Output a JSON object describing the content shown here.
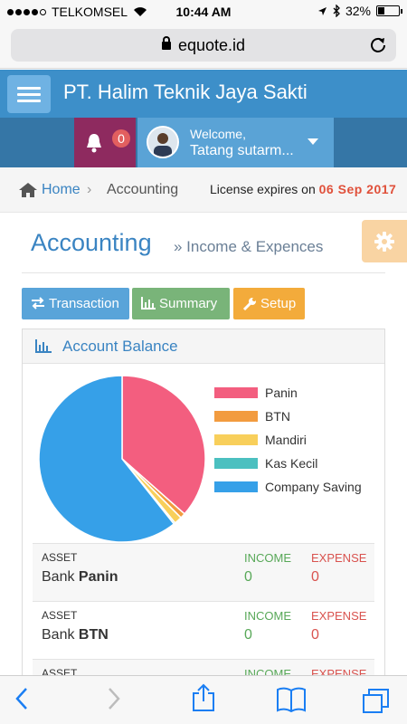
{
  "status_bar": {
    "carrier": "TELKOMSEL",
    "time": "10:44 AM",
    "battery_text": "32%",
    "battery_level": 0.32
  },
  "browser": {
    "url": "equote.id"
  },
  "header": {
    "company": "PT. Halim Teknik Jaya Sakti"
  },
  "notifications": {
    "count": "0"
  },
  "user": {
    "welcome": "Welcome,",
    "name": "Tatang sutarm..."
  },
  "breadcrumb": {
    "home": "Home",
    "separator": "›",
    "current": "Accounting"
  },
  "license": {
    "label": "License expires on",
    "date": "06 Sep 2017"
  },
  "page": {
    "title": "Accounting",
    "subtitle": "» Income & Expences"
  },
  "buttons": {
    "transaction": "Transaction",
    "summary": "Summary",
    "setup": "Setup"
  },
  "panel": {
    "title": "Account Balance"
  },
  "chart_data": {
    "type": "pie",
    "labels": [
      "Panin",
      "BTN",
      "Mandiri",
      "Kas Kecil",
      "Company Saving"
    ],
    "values": [
      36.5,
      1.0,
      1.5,
      0.3,
      60.7
    ],
    "colors": [
      "#f35e7f",
      "#f29b3f",
      "#f8cf5b",
      "#4bc0c0",
      "#36a0e8"
    ],
    "legend": "right"
  },
  "table": {
    "headers": {
      "asset": "ASSET",
      "income": "INCOME",
      "expense": "EXPENSE"
    },
    "rows": [
      {
        "prefix": "Bank",
        "name": "Panin",
        "income": "0",
        "expense": "0"
      },
      {
        "prefix": "Bank",
        "name": "BTN",
        "income": "0",
        "expense": "0"
      },
      {
        "prefix": "",
        "name": "",
        "income": "",
        "expense": ""
      }
    ]
  }
}
